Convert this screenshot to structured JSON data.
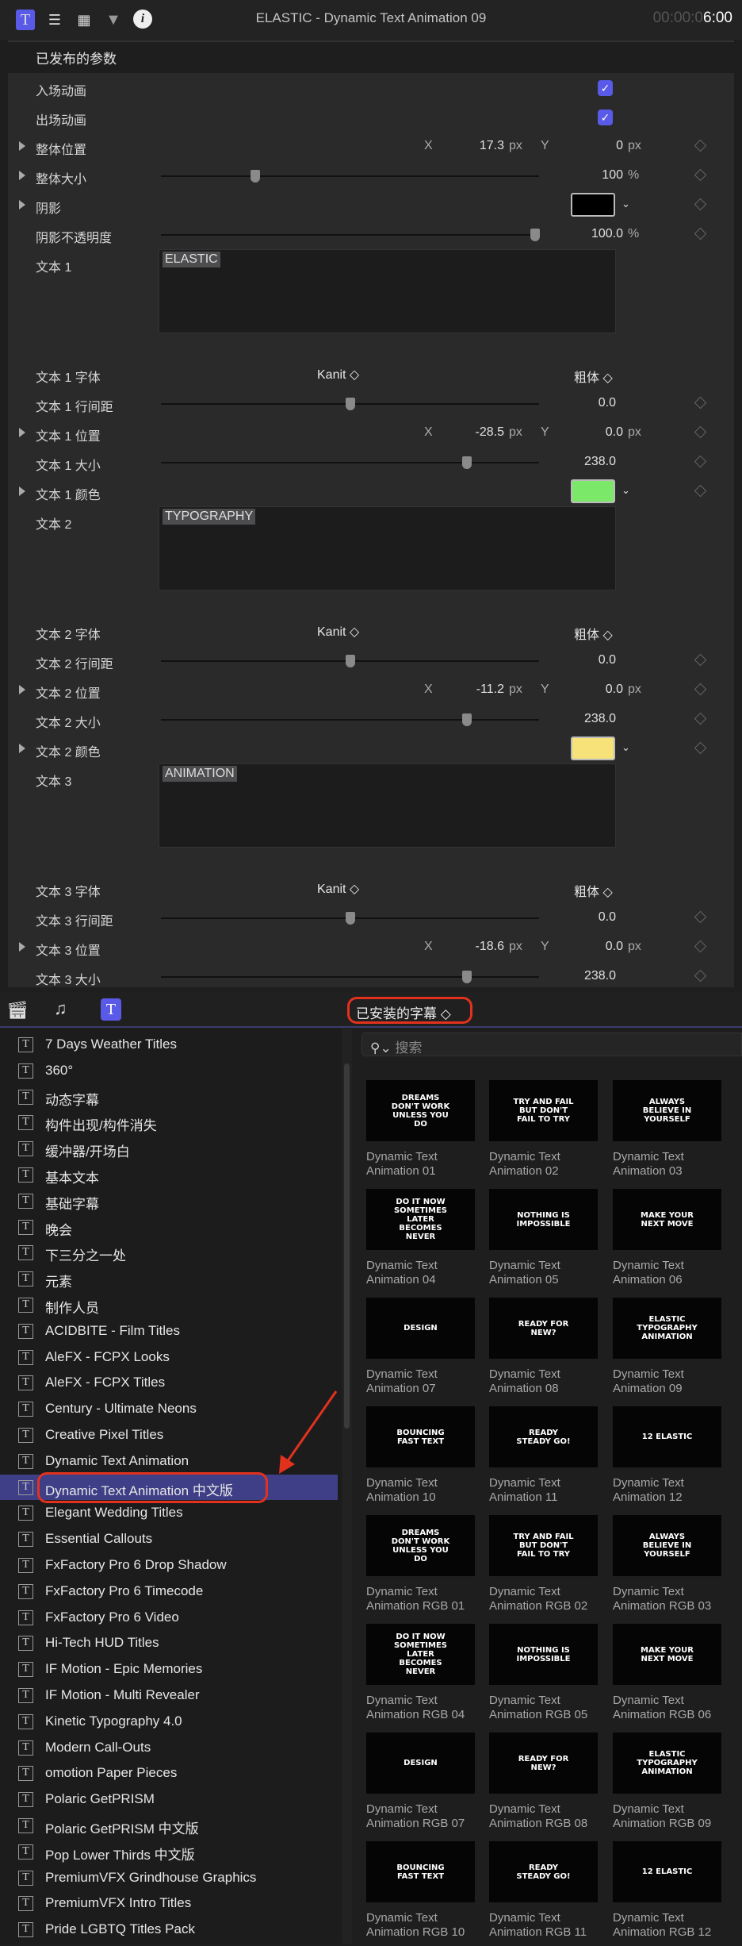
{
  "header": {
    "title": "ELASTIC - Dynamic Text Animation 09",
    "timecode_dim": "00:00:0",
    "timecode_main": "6:00",
    "icons": [
      "text-inspector-icon",
      "lines-icon",
      "film-icon",
      "filter-icon",
      "info-icon"
    ]
  },
  "published_heading": "已发布的参数",
  "params": [
    {
      "type": "check",
      "label": "入场动画",
      "checked": true
    },
    {
      "type": "check",
      "label": "出场动画",
      "checked": true
    },
    {
      "type": "xy",
      "label": "整体位置",
      "x": "17.3",
      "y": "0",
      "unit": "px",
      "xl": "X",
      "yl": "Y"
    },
    {
      "type": "slider",
      "label": "整体大小",
      "value": "100",
      "unit": "%",
      "frac": 0.25,
      "tri": true
    },
    {
      "type": "color",
      "label": "阴影",
      "color": "#000000"
    },
    {
      "type": "slider",
      "label": "阴影不透明度",
      "value": "100.0",
      "unit": "%",
      "frac": 0.99,
      "tri": false
    },
    {
      "type": "text",
      "label": "文本 1",
      "value": "ELASTIC"
    },
    {
      "type": "font",
      "label": "文本 1 字体",
      "font": "Kanit",
      "style": "粗体"
    },
    {
      "type": "slider",
      "label": "文本 1 行间距",
      "value": "0.0",
      "unit": "",
      "frac": 0.5,
      "tri": false
    },
    {
      "type": "xy",
      "label": "文本 1 位置",
      "x": "-28.5",
      "y": "0.0",
      "unit": "px",
      "xl": "X",
      "yl": "Y"
    },
    {
      "type": "slider",
      "label": "文本 1 大小",
      "value": "238.0",
      "unit": "",
      "frac": 0.81,
      "tri": false
    },
    {
      "type": "color",
      "label": "文本 1 颜色",
      "color": "#7be86a"
    },
    {
      "type": "text",
      "label": "文本 2",
      "value": "TYPOGRAPHY"
    },
    {
      "type": "font",
      "label": "文本 2 字体",
      "font": "Kanit",
      "style": "粗体"
    },
    {
      "type": "slider",
      "label": "文本 2 行间距",
      "value": "0.0",
      "unit": "",
      "frac": 0.5,
      "tri": false
    },
    {
      "type": "xy",
      "label": "文本 2 位置",
      "x": "-11.2",
      "y": "0.0",
      "unit": "px",
      "xl": "X",
      "yl": "Y"
    },
    {
      "type": "slider",
      "label": "文本 2 大小",
      "value": "238.0",
      "unit": "",
      "frac": 0.81,
      "tri": false
    },
    {
      "type": "color",
      "label": "文本 2 颜色",
      "color": "#f7e27a"
    },
    {
      "type": "text",
      "label": "文本 3",
      "value": "ANIMATION"
    },
    {
      "type": "font",
      "label": "文本 3 字体",
      "font": "Kanit",
      "style": "粗体"
    },
    {
      "type": "slider",
      "label": "文本 3 行间距",
      "value": "0.0",
      "unit": "",
      "frac": 0.5,
      "tri": false
    },
    {
      "type": "xy",
      "label": "文本 3 位置",
      "x": "-18.6",
      "y": "0.0",
      "unit": "px",
      "xl": "X",
      "yl": "Y"
    },
    {
      "type": "slider",
      "label": "文本 3 大小",
      "value": "238.0",
      "unit": "",
      "frac": 0.81,
      "tri": false
    }
  ],
  "browser": {
    "dropdown": "已安装的字幕 ◇",
    "search_placeholder": "搜索",
    "accent": "#3e3f86"
  },
  "categories": [
    "7 Days Weather Titles",
    "360°",
    "动态字幕",
    "构件出现/构件消失",
    "缓冲器/开场白",
    "基本文本",
    "基础字幕",
    "晚会",
    "下三分之一处",
    "元素",
    "制作人员",
    "ACIDBITE - Film Titles",
    "AleFX - FCPX Looks",
    "AleFX - FCPX Titles",
    "Century - Ultimate Neons",
    "Creative Pixel Titles",
    "Dynamic Text Animation",
    "Dynamic Text Animation 中文版",
    "Elegant Wedding Titles",
    "Essential Callouts",
    "FxFactory Pro 6 Drop Shadow",
    "FxFactory Pro 6 Timecode",
    "FxFactory Pro 6 Video",
    "Hi-Tech HUD Titles",
    "IF Motion - Epic Memories",
    "IF Motion - Multi Revealer",
    "Kinetic Typography 4.0",
    "Modern Call-Outs",
    "omotion Paper Pieces",
    "Polaric GetPRISM",
    "Polaric GetPRISM 中文版",
    "Pop Lower Thirds 中文版",
    "PremiumVFX Grindhouse Graphics",
    "PremiumVFX Intro Titles",
    "Pride LGBTQ Titles Pack"
  ],
  "selected_category": 17,
  "items": [
    {
      "l1": "Dynamic Text",
      "l2": "Animation 01",
      "thumb": "DREAMS DON'T WORK UNLESS YOU DO"
    },
    {
      "l1": "Dynamic Text",
      "l2": "Animation 02",
      "thumb": "TRY AND FAIL BUT DON'T FAIL TO TRY"
    },
    {
      "l1": "Dynamic Text",
      "l2": "Animation 03",
      "thumb": "ALWAYS BELIEVE IN YOURSELF"
    },
    {
      "l1": "Dynamic Text",
      "l2": "Animation 04",
      "thumb": "DO IT NOW SOMETIMES LATER BECOMES NEVER"
    },
    {
      "l1": "Dynamic Text",
      "l2": "Animation 05",
      "thumb": "NOTHING IS IMPOSSIBLE"
    },
    {
      "l1": "Dynamic Text",
      "l2": "Animation 06",
      "thumb": "MAKE YOUR NEXT MOVE"
    },
    {
      "l1": "Dynamic Text",
      "l2": "Animation 07",
      "thumb": "DESIGN"
    },
    {
      "l1": "Dynamic Text",
      "l2": "Animation 08",
      "thumb": "READY FOR NEW?"
    },
    {
      "l1": "Dynamic Text",
      "l2": "Animation 09",
      "thumb": "ELASTIC TYPOGRAPHY ANIMATION"
    },
    {
      "l1": "Dynamic Text",
      "l2": "Animation 10",
      "thumb": "BOUNCING FAST TEXT"
    },
    {
      "l1": "Dynamic Text",
      "l2": "Animation 11",
      "thumb": "READY STEADY GO!"
    },
    {
      "l1": "Dynamic Text",
      "l2": "Animation 12",
      "thumb": "12 ELASTIC"
    },
    {
      "l1": "Dynamic Text",
      "l2": "Animation RGB 01",
      "thumb": "DREAMS DON'T WORK UNLESS YOU DO"
    },
    {
      "l1": "Dynamic Text",
      "l2": "Animation RGB 02",
      "thumb": "TRY AND FAIL BUT DON'T FAIL TO TRY"
    },
    {
      "l1": "Dynamic Text",
      "l2": "Animation RGB 03",
      "thumb": "ALWAYS BELIEVE IN YOURSELF"
    },
    {
      "l1": "Dynamic Text",
      "l2": "Animation RGB 04",
      "thumb": "DO IT NOW SOMETIMES LATER BECOMES NEVER"
    },
    {
      "l1": "Dynamic Text",
      "l2": "Animation RGB 05",
      "thumb": "NOTHING IS IMPOSSIBLE"
    },
    {
      "l1": "Dynamic Text",
      "l2": "Animation RGB 06",
      "thumb": "MAKE YOUR NEXT MOVE"
    },
    {
      "l1": "Dynamic Text",
      "l2": "Animation RGB 07",
      "thumb": "DESIGN"
    },
    {
      "l1": "Dynamic Text",
      "l2": "Animation RGB 08",
      "thumb": "READY FOR NEW?"
    },
    {
      "l1": "Dynamic Text",
      "l2": "Animation RGB 09",
      "thumb": "ELASTIC TYPOGRAPHY ANIMATION"
    },
    {
      "l1": "Dynamic Text",
      "l2": "Animation RGB 10",
      "thumb": "BOUNCING FAST TEXT"
    },
    {
      "l1": "Dynamic Text",
      "l2": "Animation RGB 11",
      "thumb": "READY STEADY GO!"
    },
    {
      "l1": "Dynamic Text",
      "l2": "Animation RGB 12",
      "thumb": "12 ELASTIC"
    }
  ]
}
